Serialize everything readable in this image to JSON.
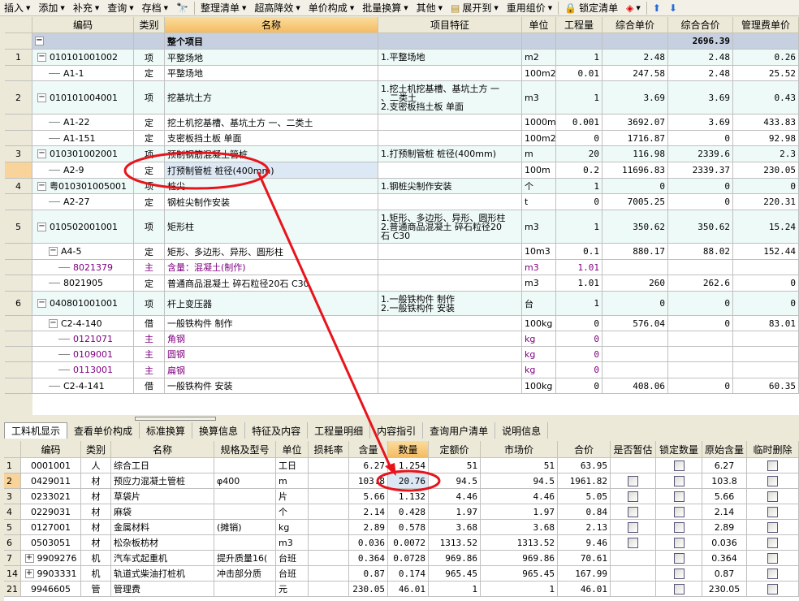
{
  "toolbar": [
    {
      "label": "插入",
      "dropdown": true
    },
    {
      "label": "添加",
      "dropdown": true
    },
    {
      "label": "补充",
      "dropdown": true
    },
    {
      "label": "查询",
      "dropdown": true
    },
    {
      "label": "存档",
      "dropdown": true
    },
    {
      "label": "",
      "icon": "binoculars-icon"
    },
    {
      "label": "整理清单",
      "dropdown": true
    },
    {
      "label": "超高降效",
      "dropdown": true
    },
    {
      "label": "单价构成",
      "dropdown": true
    },
    {
      "label": "批量换算",
      "dropdown": true
    },
    {
      "label": "其他",
      "dropdown": true
    },
    {
      "label": "展开到",
      "dropdown": true,
      "icon": "tree-expand-icon"
    },
    {
      "label": "重用组价",
      "dropdown": true
    },
    {
      "label": "锁定清单",
      "icon": "lock-icon"
    },
    {
      "label": "",
      "icon": "paint-bucket-icon",
      "dropdown": true
    },
    {
      "label": "",
      "icon": "arrow-up-icon"
    },
    {
      "label": "",
      "icon": "arrow-down-icon"
    }
  ],
  "top_grid": {
    "columns": [
      "",
      "编码",
      "类别",
      "名称",
      "项目特征",
      "单位",
      "工程量",
      "综合单价",
      "综合合价",
      "管理费单价"
    ],
    "total": {
      "name": "整个项目",
      "total_price": "2696.39"
    },
    "rows": [
      {
        "no": "1",
        "code": "010101001002",
        "type": "项",
        "name": "平整场地",
        "feature": "1.平整场地",
        "unit": "m2",
        "qty": "1",
        "unit_price": "2.48",
        "total": "2.48",
        "mgmt": "0.26",
        "kind": "item"
      },
      {
        "no": "",
        "code": "A1-1",
        "type": "定",
        "name": "平整场地",
        "feature": "",
        "unit": "100m2",
        "qty": "0.01",
        "unit_price": "247.58",
        "total": "2.48",
        "mgmt": "25.52",
        "kind": "quota"
      },
      {
        "no": "2",
        "code": "010101004001",
        "type": "项",
        "name": "挖基坑土方",
        "feature": "1.挖土机挖基槽、基坑土方 一\n、二类土\n2.支密板挡土板 单面",
        "unit": "m3",
        "qty": "1",
        "unit_price": "3.69",
        "total": "3.69",
        "mgmt": "0.43",
        "kind": "item"
      },
      {
        "no": "",
        "code": "A1-22",
        "type": "定",
        "name": "挖土机挖基槽、基坑土方 一、二类土",
        "feature": "",
        "unit": "1000m3",
        "qty": "0.001",
        "unit_price": "3692.07",
        "total": "3.69",
        "mgmt": "433.83",
        "kind": "quota"
      },
      {
        "no": "",
        "code": "A1-151",
        "type": "定",
        "name": "支密板挡土板 单面",
        "feature": "",
        "unit": "100m2",
        "qty": "0",
        "unit_price": "1716.87",
        "total": "0",
        "mgmt": "92.98",
        "kind": "quota"
      },
      {
        "no": "3",
        "code": "010301002001",
        "type": "项",
        "name": "预制钢筋混凝土管桩",
        "feature": "1.打预制管桩 桩径(400mm)",
        "unit": "m",
        "qty": "20",
        "unit_price": "116.98",
        "total": "2339.6",
        "mgmt": "2.3",
        "kind": "item"
      },
      {
        "no": "",
        "code": "A2-9",
        "type": "定",
        "name": "打预制管桩 桩径(400mm)",
        "feature": "",
        "unit": "100m",
        "qty": "0.2",
        "unit_price": "11696.83",
        "total": "2339.37",
        "mgmt": "230.05",
        "kind": "quota",
        "selected": true
      },
      {
        "no": "4",
        "code": "粤010301005001",
        "type": "项",
        "name": "桩尖",
        "feature": "1.钢桩尖制作安装",
        "unit": "个",
        "qty": "1",
        "unit_price": "0",
        "total": "0",
        "mgmt": "0",
        "kind": "item"
      },
      {
        "no": "",
        "code": "A2-27",
        "type": "定",
        "name": "钢桩尖制作安装",
        "feature": "",
        "unit": "t",
        "qty": "0",
        "unit_price": "7005.25",
        "total": "0",
        "mgmt": "220.31",
        "kind": "quota"
      },
      {
        "no": "5",
        "code": "010502001001",
        "type": "项",
        "name": "矩形柱",
        "feature": "1.矩形、多边形、异形、圆形柱\n2.普通商品混凝土 碎石粒径20\n石 C30",
        "unit": "m3",
        "qty": "1",
        "unit_price": "350.62",
        "total": "350.62",
        "mgmt": "15.24",
        "kind": "item"
      },
      {
        "no": "",
        "code": "A4-5",
        "type": "定",
        "name": "矩形、多边形、异形、圆形柱",
        "feature": "",
        "unit": "10m3",
        "qty": "0.1",
        "unit_price": "880.17",
        "total": "88.02",
        "mgmt": "152.44",
        "kind": "quota",
        "expand": true
      },
      {
        "no": "",
        "code": "8021379",
        "type": "主",
        "name": "含量：混凝土(制作)",
        "feature": "",
        "unit": "m3",
        "qty": "1.01",
        "unit_price": "",
        "total": "",
        "mgmt": "",
        "kind": "main"
      },
      {
        "no": "",
        "code": "8021905",
        "type": "定",
        "name": "普通商品混凝土 碎石粒径20石 C30",
        "feature": "",
        "unit": "m3",
        "qty": "1.01",
        "unit_price": "260",
        "total": "262.6",
        "mgmt": "0",
        "kind": "quota"
      },
      {
        "no": "6",
        "code": "040801001001",
        "type": "项",
        "name": "杆上变压器",
        "feature": "1.一般铁构件 制作\n2.一般铁构件 安装",
        "unit": "台",
        "qty": "1",
        "unit_price": "0",
        "total": "0",
        "mgmt": "0",
        "kind": "item"
      },
      {
        "no": "",
        "code": "C2-4-140",
        "type": "借",
        "name": "一般铁构件 制作",
        "feature": "",
        "unit": "100kg",
        "qty": "0",
        "unit_price": "576.04",
        "total": "0",
        "mgmt": "83.01",
        "kind": "quota",
        "expand": true
      },
      {
        "no": "",
        "code": "0121071",
        "type": "主",
        "name": "角钢",
        "feature": "",
        "unit": "kg",
        "qty": "0",
        "unit_price": "",
        "total": "",
        "mgmt": "",
        "kind": "main"
      },
      {
        "no": "",
        "code": "0109001",
        "type": "主",
        "name": "圆钢",
        "feature": "",
        "unit": "kg",
        "qty": "0",
        "unit_price": "",
        "total": "",
        "mgmt": "",
        "kind": "main"
      },
      {
        "no": "",
        "code": "0113001",
        "type": "主",
        "name": "扁钢",
        "feature": "",
        "unit": "kg",
        "qty": "0",
        "unit_price": "",
        "total": "",
        "mgmt": "",
        "kind": "main"
      },
      {
        "no": "",
        "code": "C2-4-141",
        "type": "借",
        "name": "一般铁构件 安装",
        "feature": "",
        "unit": "100kg",
        "qty": "0",
        "unit_price": "408.06",
        "total": "0",
        "mgmt": "60.35",
        "kind": "quota"
      }
    ]
  },
  "tabs": [
    {
      "label": "工料机显示",
      "active": true
    },
    {
      "label": "查看单价构成"
    },
    {
      "label": "标准换算"
    },
    {
      "label": "换算信息"
    },
    {
      "label": "特征及内容"
    },
    {
      "label": "工程量明细"
    },
    {
      "label": "内容指引"
    },
    {
      "label": "查询用户清单"
    },
    {
      "label": "说明信息"
    }
  ],
  "bottom_grid": {
    "columns": [
      "",
      "编码",
      "类别",
      "名称",
      "规格及型号",
      "单位",
      "损耗率",
      "含量",
      "数量",
      "定额价",
      "市场价",
      "合价",
      "是否暂估",
      "锁定数量",
      "原始含量",
      "临时删除"
    ],
    "rows": [
      {
        "no": "1",
        "code": "0001001",
        "type": "人",
        "name": "综合工日",
        "spec": "",
        "unit": "工日",
        "loss": "",
        "content": "6.27",
        "qty": "1.254",
        "quota_price": "51",
        "market_price": "51",
        "total": "63.95",
        "estimate": null,
        "lock": false,
        "orig": "6.27",
        "del": false
      },
      {
        "no": "2",
        "code": "0429011",
        "type": "材",
        "name": "预应力混凝土管桩",
        "spec": "φ400",
        "unit": "m",
        "loss": "",
        "content": "103.8",
        "qty": "20.76",
        "quota_price": "94.5",
        "market_price": "94.5",
        "total": "1961.82",
        "estimate": false,
        "lock": false,
        "orig": "103.8",
        "del": false,
        "selected": true
      },
      {
        "no": "3",
        "code": "0233021",
        "type": "材",
        "name": "草袋片",
        "spec": "",
        "unit": "片",
        "loss": "",
        "content": "5.66",
        "qty": "1.132",
        "quota_price": "4.46",
        "market_price": "4.46",
        "total": "5.05",
        "estimate": false,
        "lock": false,
        "orig": "5.66",
        "del": false
      },
      {
        "no": "4",
        "code": "0229031",
        "type": "材",
        "name": "麻袋",
        "spec": "",
        "unit": "个",
        "loss": "",
        "content": "2.14",
        "qty": "0.428",
        "quota_price": "1.97",
        "market_price": "1.97",
        "total": "0.84",
        "estimate": false,
        "lock": false,
        "orig": "2.14",
        "del": false
      },
      {
        "no": "5",
        "code": "0127001",
        "type": "材",
        "name": "金属材料",
        "spec": "(摊销)",
        "unit": "kg",
        "loss": "",
        "content": "2.89",
        "qty": "0.578",
        "quota_price": "3.68",
        "market_price": "3.68",
        "total": "2.13",
        "estimate": false,
        "lock": false,
        "orig": "2.89",
        "del": false
      },
      {
        "no": "6",
        "code": "0503051",
        "type": "材",
        "name": "松杂板枋材",
        "spec": "",
        "unit": "m3",
        "loss": "",
        "content": "0.036",
        "qty": "0.0072",
        "quota_price": "1313.52",
        "market_price": "1313.52",
        "total": "9.46",
        "estimate": false,
        "lock": false,
        "orig": "0.036",
        "del": false
      },
      {
        "no": "7",
        "code": "9909276",
        "type": "机",
        "name": "汽车式起重机",
        "spec": "提升质量16(",
        "unit": "台班",
        "loss": "",
        "content": "0.364",
        "qty": "0.0728",
        "quota_price": "969.86",
        "market_price": "969.86",
        "total": "70.61",
        "estimate": null,
        "lock": false,
        "orig": "0.364",
        "del": false,
        "expand": true
      },
      {
        "no": "14",
        "code": "9903331",
        "type": "机",
        "name": "轨道式柴油打桩机",
        "spec": "冲击部分质",
        "unit": "台班",
        "loss": "",
        "content": "0.87",
        "qty": "0.174",
        "quota_price": "965.45",
        "market_price": "965.45",
        "total": "167.99",
        "estimate": null,
        "lock": false,
        "orig": "0.87",
        "del": false,
        "expand": true
      },
      {
        "no": "21",
        "code": "9946605",
        "type": "管",
        "name": "管理费",
        "spec": "",
        "unit": "元",
        "loss": "",
        "content": "230.05",
        "qty": "46.01",
        "quota_price": "1",
        "market_price": "1",
        "total": "46.01",
        "estimate": null,
        "lock": false,
        "orig": "230.05",
        "del": false
      }
    ]
  },
  "colors": {
    "annotation": "#e8141c",
    "main_material": "#800080",
    "item_row": "#eefaf8",
    "selected_cell": "#dde8f5",
    "sorted_header": "#f4bc64"
  }
}
